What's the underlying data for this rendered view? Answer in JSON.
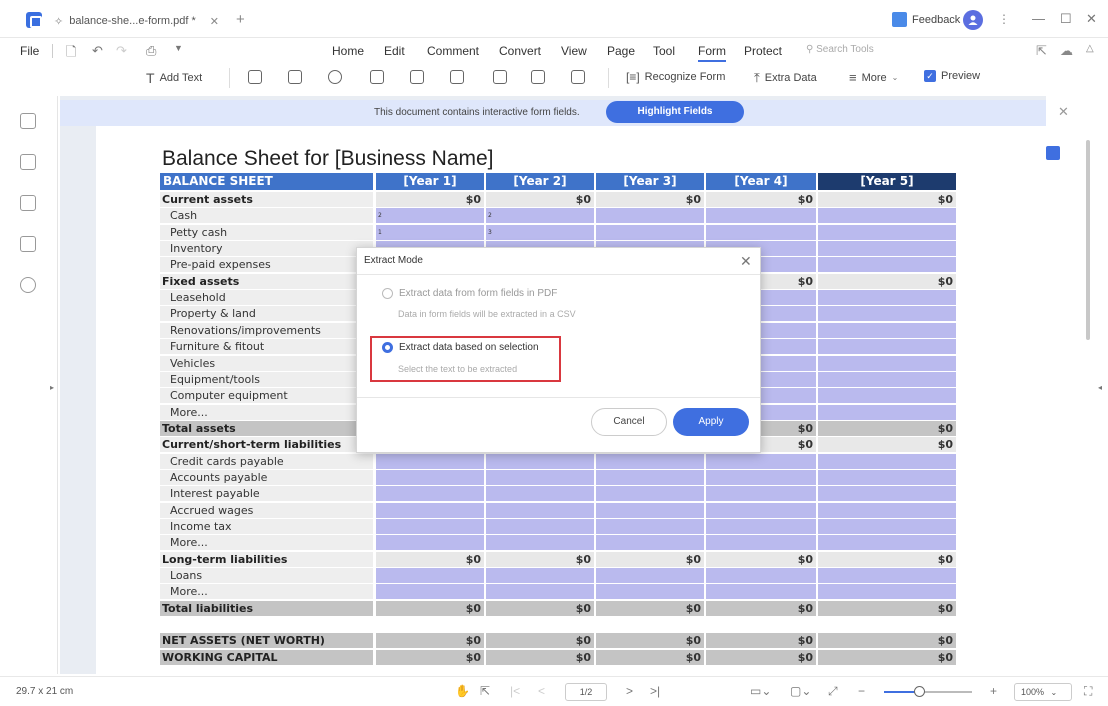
{
  "titlebar": {
    "tab_title": "balance-she...e-form.pdf *",
    "feedback_label": "Feedback",
    "window_controls": [
      "—",
      "☐",
      "✕"
    ]
  },
  "menu": {
    "file": "File",
    "items": [
      "Home",
      "Edit",
      "Comment",
      "Convert",
      "View",
      "Page",
      "Tool",
      "Form",
      "Protect"
    ],
    "active": "Form",
    "search_placeholder": "Search Tools"
  },
  "toolbar": {
    "add_text": "Add Text",
    "recognize_form": "Recognize Form",
    "extra_data": "Extra Data",
    "more": "More",
    "preview": "Preview",
    "preview_checked": true
  },
  "notification": {
    "text": "This document contains interactive form fields.",
    "button": "Highlight Fields"
  },
  "sheet": {
    "title": "Balance Sheet for [Business Name]",
    "header_label": "BALANCE SHEET",
    "years": [
      "[Year 1]",
      "[Year 2]",
      "[Year 3]",
      "[Year 4]",
      "[Year 5]"
    ],
    "header_colors": [
      "#3f73c9",
      "#3f73c9",
      "#3f73c9",
      "#3f73c9",
      "#1d3b6e"
    ],
    "rows": [
      {
        "label": "Current assets",
        "type": "head",
        "values": [
          "$0",
          "$0",
          "$0",
          "$0",
          "$0"
        ]
      },
      {
        "label": "Cash",
        "type": "item",
        "marks": [
          "2",
          "2",
          "",
          "",
          ""
        ]
      },
      {
        "label": "Petty cash",
        "type": "item",
        "marks": [
          "1",
          "3",
          "",
          "",
          ""
        ]
      },
      {
        "label": "Inventory",
        "type": "item"
      },
      {
        "label": "Pre-paid expenses",
        "type": "item"
      },
      {
        "label": "Fixed assets",
        "type": "head",
        "values": [
          "",
          "",
          "",
          "$0",
          "$0"
        ]
      },
      {
        "label": "Leasehold",
        "type": "item"
      },
      {
        "label": "Property & land",
        "type": "item"
      },
      {
        "label": "Renovations/improvements",
        "type": "item"
      },
      {
        "label": "Furniture & fitout",
        "type": "item"
      },
      {
        "label": "Vehicles",
        "type": "item"
      },
      {
        "label": "Equipment/tools",
        "type": "item"
      },
      {
        "label": "Computer equipment",
        "type": "item"
      },
      {
        "label": "More...",
        "type": "item"
      },
      {
        "label": "Total assets",
        "type": "total",
        "values": [
          "",
          "",
          "",
          "$0",
          "$0"
        ]
      },
      {
        "label": "Current/short-term liabilities",
        "type": "head",
        "values": [
          "",
          "",
          "",
          "$0",
          "$0"
        ]
      },
      {
        "label": "Credit cards payable",
        "type": "item"
      },
      {
        "label": "Accounts payable",
        "type": "item"
      },
      {
        "label": "Interest payable",
        "type": "item"
      },
      {
        "label": "Accrued wages",
        "type": "item"
      },
      {
        "label": "Income tax",
        "type": "item"
      },
      {
        "label": "More...",
        "type": "item"
      },
      {
        "label": "Long-term liabilities",
        "type": "head",
        "values": [
          "$0",
          "$0",
          "$0",
          "$0",
          "$0"
        ]
      },
      {
        "label": "Loans",
        "type": "item"
      },
      {
        "label": "More...",
        "type": "item"
      },
      {
        "label": "Total liabilities",
        "type": "total",
        "values": [
          "$0",
          "$0",
          "$0",
          "$0",
          "$0"
        ]
      },
      {
        "label": "",
        "type": "blank"
      },
      {
        "label": "NET ASSETS (NET WORTH)",
        "type": "total",
        "values": [
          "$0",
          "$0",
          "$0",
          "$0",
          "$0"
        ]
      },
      {
        "label": "WORKING CAPITAL",
        "type": "total",
        "values": [
          "$0",
          "$0",
          "$0",
          "$0",
          "$0"
        ]
      }
    ]
  },
  "modal": {
    "title": "Extract Mode",
    "option1_label": "Extract data from form fields in PDF",
    "option1_desc": "Data in form fields will be extracted in a CSV",
    "option2_label": "Extract data based on selection",
    "option2_desc": "Select the text to be extracted",
    "selected_option": 2,
    "cancel": "Cancel",
    "apply": "Apply"
  },
  "status": {
    "page_size": "29.7 x 21 cm",
    "page": "1/2",
    "zoom": "100%",
    "zoom_level": 0.35
  }
}
